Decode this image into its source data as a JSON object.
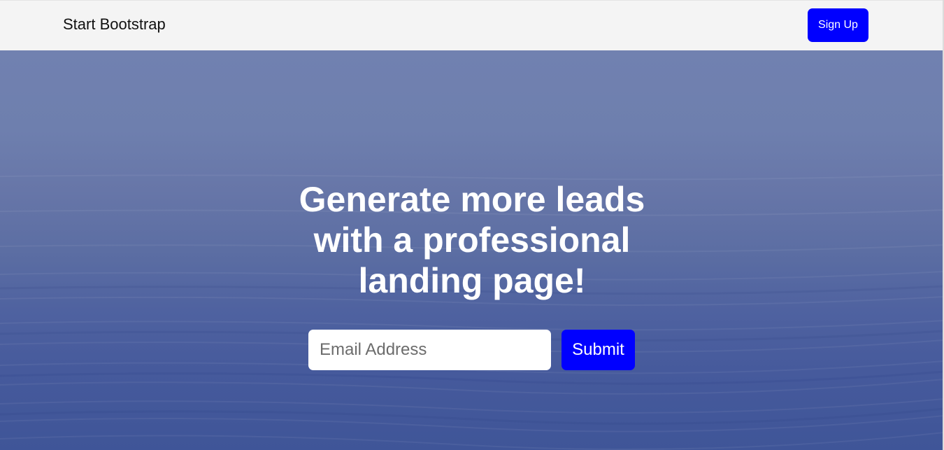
{
  "navbar": {
    "brand": "Start Bootstrap",
    "signup_label": "Sign Up"
  },
  "hero": {
    "headline": "Generate more leads with a professional landing page!",
    "email_placeholder": "Email Address",
    "submit_label": "Submit"
  },
  "colors": {
    "accent": "#0000ff",
    "navbar_bg": "#f4f4f4",
    "hero_top": "#7181b0",
    "hero_bottom": "#3f5598",
    "text_on_hero": "#ffffff"
  }
}
